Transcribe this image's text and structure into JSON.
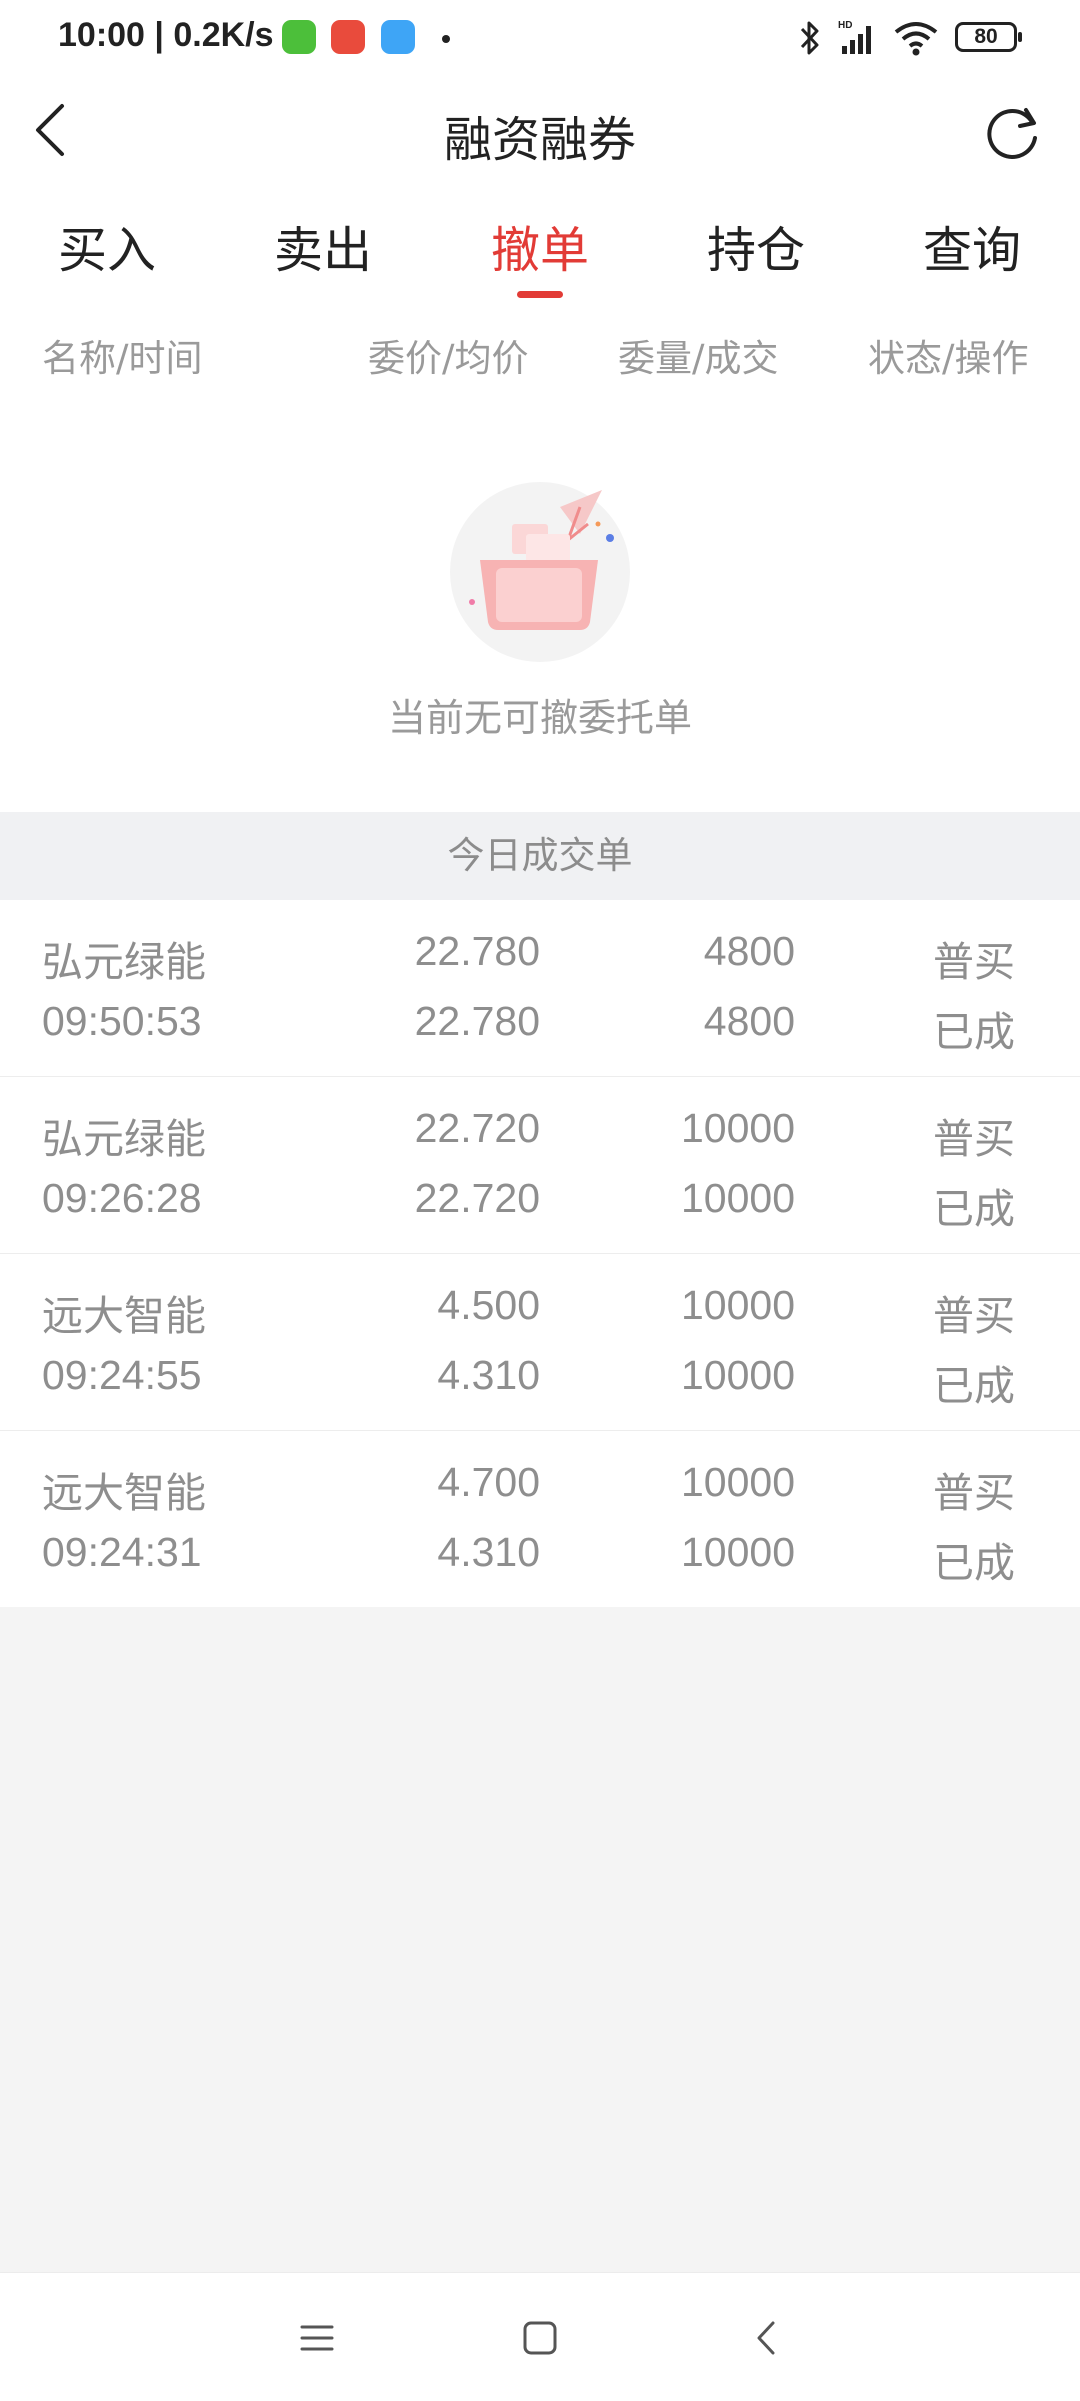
{
  "status_bar": {
    "time": "10:00 | 0.2K/s",
    "battery": "80",
    "icons": [
      "app-icon-green",
      "app-icon-red",
      "app-icon-blue",
      "bluetooth-icon",
      "signal-icon",
      "wifi-icon",
      "battery-icon"
    ]
  },
  "header": {
    "title": "融资融券"
  },
  "tabs": [
    {
      "label": "买入"
    },
    {
      "label": "卖出"
    },
    {
      "label": "撤单"
    },
    {
      "label": "持仓"
    },
    {
      "label": "查询"
    }
  ],
  "active_tab": "撤单",
  "columns": {
    "name_time": "名称/时间",
    "price": "委价/均价",
    "quantity": "委量/成交",
    "status": "状态/操作"
  },
  "empty_state": {
    "text": "当前无可撤委托单"
  },
  "today_section": {
    "title": "今日成交单"
  },
  "orders": [
    {
      "name": "弘元绿能",
      "time": "09:50:53",
      "price": "22.780",
      "avg_price": "22.780",
      "quantity": "4800",
      "deal": "4800",
      "type": "普买",
      "status": "已成"
    },
    {
      "name": "弘元绿能",
      "time": "09:26:28",
      "price": "22.720",
      "avg_price": "22.720",
      "quantity": "10000",
      "deal": "10000",
      "type": "普买",
      "status": "已成"
    },
    {
      "name": "远大智能",
      "time": "09:24:55",
      "price": "4.500",
      "avg_price": "4.310",
      "quantity": "10000",
      "deal": "10000",
      "type": "普买",
      "status": "已成"
    },
    {
      "name": "远大智能",
      "time": "09:24:31",
      "price": "4.700",
      "avg_price": "4.310",
      "quantity": "10000",
      "deal": "10000",
      "type": "普买",
      "status": "已成"
    }
  ],
  "colors": {
    "accent": "#e23b36",
    "muted_text": "#8e8e8e"
  }
}
